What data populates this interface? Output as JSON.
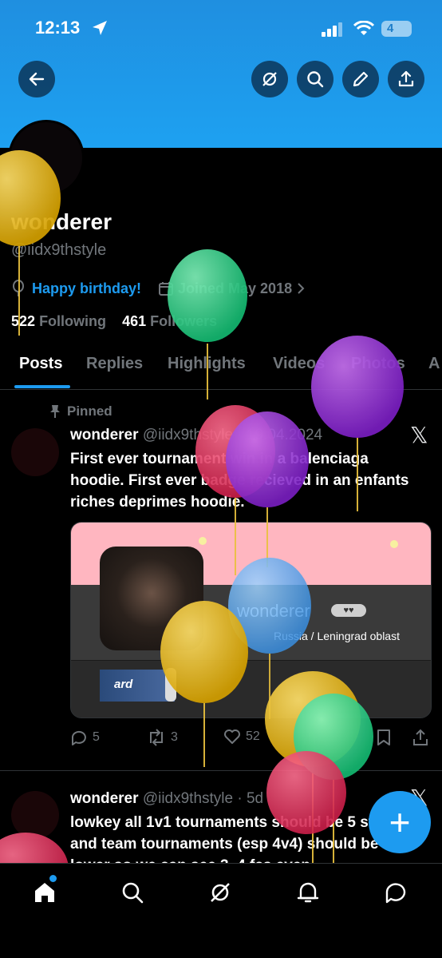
{
  "status_bar": {
    "time": "12:13",
    "battery": "4"
  },
  "profile": {
    "display_name": "wonderer",
    "handle": "@iidx9thstyle",
    "birthday": "Happy birthday!",
    "joined": "Joined May 2018",
    "following_count": "522",
    "following_label": "Following",
    "followers_count": "461",
    "followers_label": "Followers"
  },
  "tabs": [
    {
      "label": "Posts"
    },
    {
      "label": "Replies"
    },
    {
      "label": "Highlights"
    },
    {
      "label": "Videos"
    },
    {
      "label": "Photos"
    },
    {
      "label": "A"
    }
  ],
  "pinned_label": "Pinned",
  "posts": [
    {
      "name": "wonderer",
      "handle": "@iidx9thstyle",
      "date": "· 19.04.2024",
      "text": "First ever tournament win in a balenciaga hoodie. First ever badge recieved in an enfants riches deprimes hoodie.",
      "card": {
        "name": "wonderer",
        "badge": "♥♥",
        "location": "Russia / Leningrad oblast",
        "sticker": "ard"
      },
      "replies": "5",
      "reposts": "3",
      "likes": "52"
    },
    {
      "name": "wonderer",
      "handle": "@iidx9thstyle",
      "date": "· 5d",
      "text": "lowkey all 1v1 tournaments should be 5 stars and team tournaments (esp 4v4) should be lower so we can see 3–4 fcs even"
    }
  ],
  "fab_label": "+",
  "colors": {
    "accent": "#1d9bf0",
    "banner": "#1ea1f1",
    "background": "#000000"
  }
}
